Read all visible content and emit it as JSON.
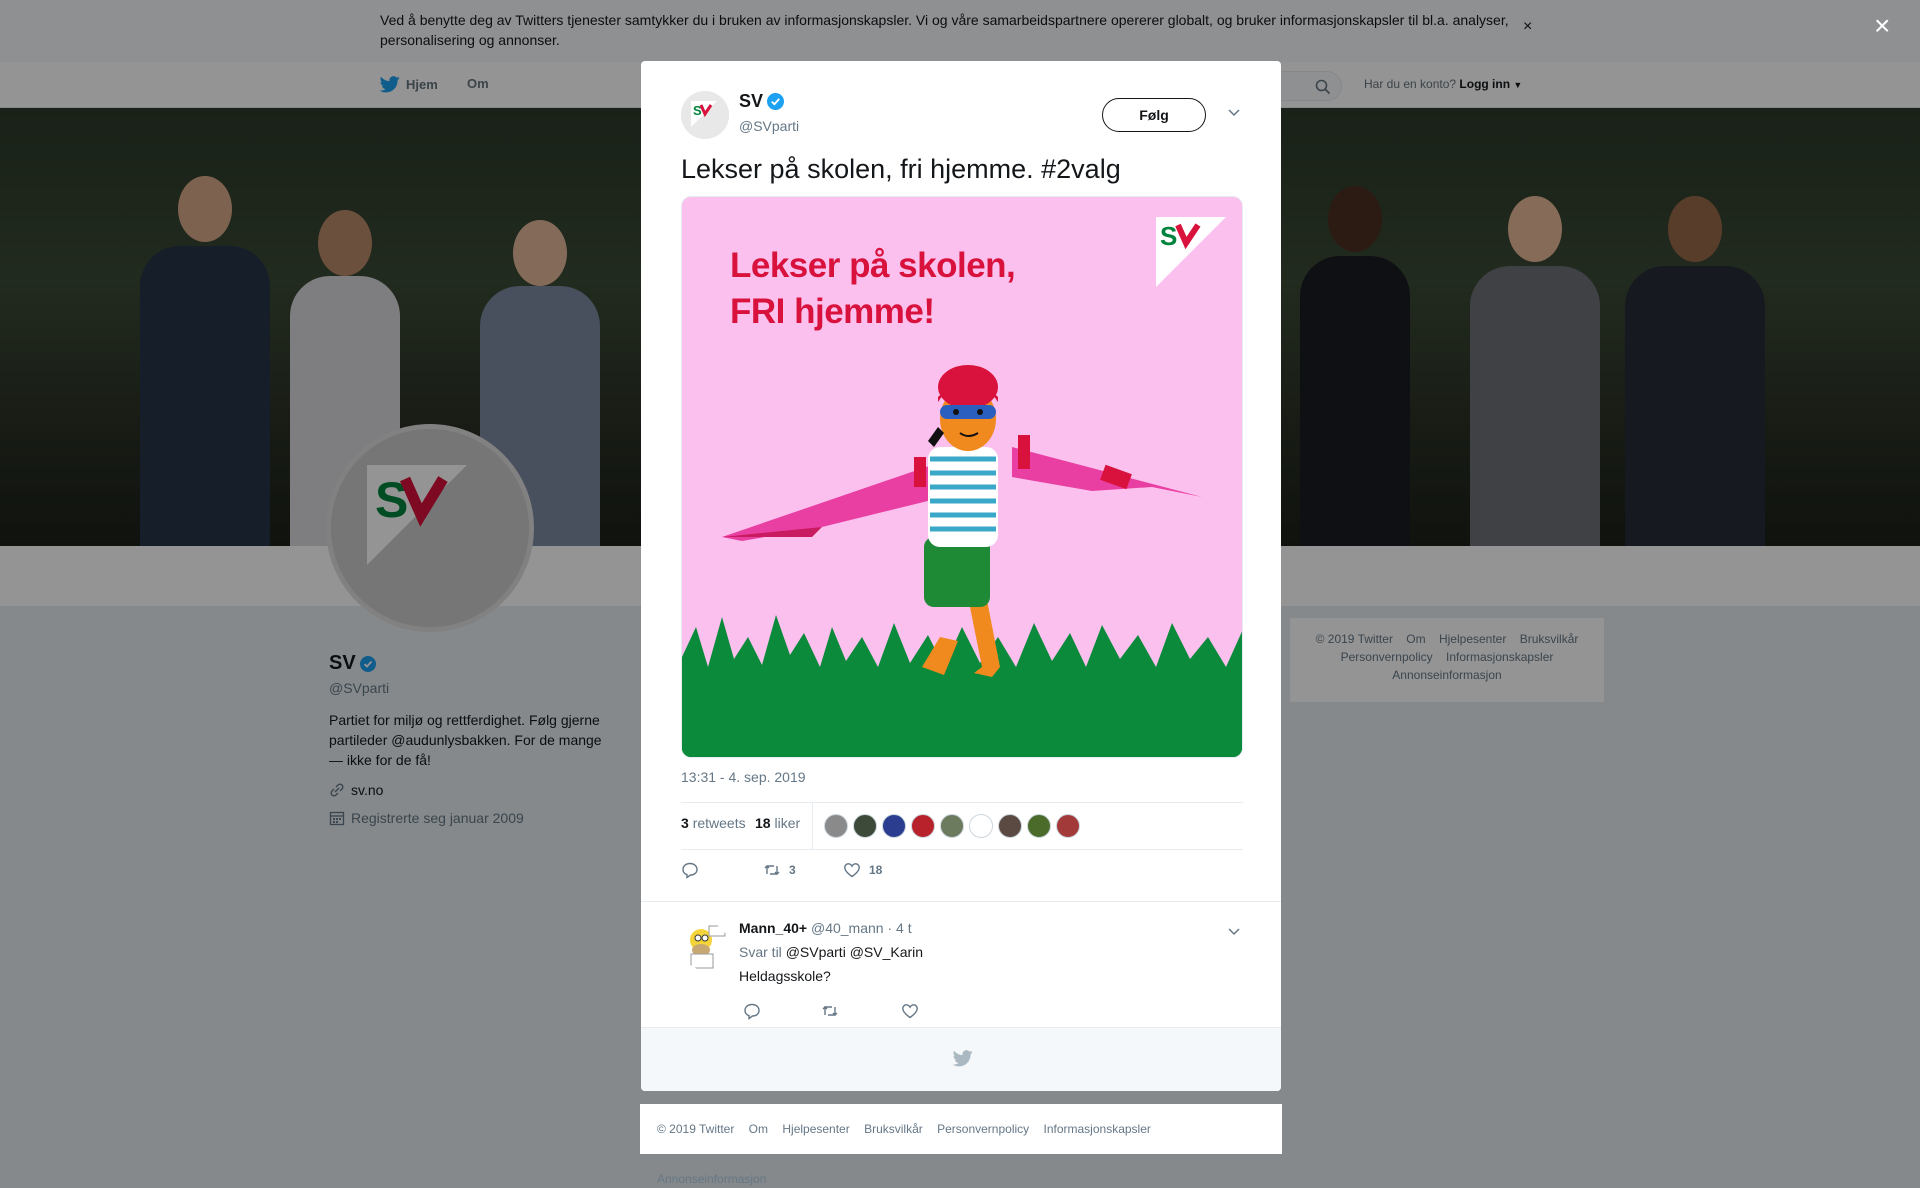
{
  "cookie": {
    "text": "Ved å benytte deg av Twitters tjenester samtykker du i bruken av informasjonskapsler. Vi og våre samarbeidspartnere opererer globalt, og bruker informasjonskapsler til bl.a. analyser, personalisering og annonser.",
    "close": "×"
  },
  "nav": {
    "home": "Hjem",
    "about": "Om",
    "have_account": "Har du en konto?",
    "login": "Logg inn"
  },
  "profile": {
    "name": "SV",
    "handle": "@SVparti",
    "bio": "Partiet for miljø og rettferdighet. Følg gjerne partileder @audunlysbakken. For de mange — ikke for de få!",
    "link": "sv.no",
    "joined": "Registrerte seg januar 2009"
  },
  "side_footer": [
    "© 2019 Twitter",
    "Om",
    "Hjelpesenter",
    "Bruksvilkår",
    "Personvernpolicy",
    "Informasjonskapsler",
    "Annonseinformasjon"
  ],
  "overlay_close": "×",
  "tweet": {
    "name": "SV",
    "handle": "@SVparti",
    "follow": "Følg",
    "text": "Lekser på skolen, fri hjemme. #2valg",
    "media_line1": "Lekser på skolen,",
    "media_line2": "FRI hjemme!",
    "media_logo": "SV",
    "time": "13:31 - 4. sep. 2019",
    "retweets_count": "3",
    "retweets_label": "retweets",
    "likes_count": "18",
    "likes_label": "liker",
    "action_retweets": "3",
    "action_likes": "18",
    "liker_colors": [
      "#8a8a8a",
      "#3d4a3a",
      "#2a3d8f",
      "#b8222b",
      "#6c7a5e",
      "#ffffff",
      "#5b4a42",
      "#4a6b2a",
      "#a33a3a"
    ]
  },
  "reply": {
    "name": "Mann_40+",
    "handle": "@40_mann",
    "time": "· 4 t",
    "reply_to_label": "Svar til",
    "mentions": "@SVparti @SV_Karin",
    "text": "Heldagsskole?"
  },
  "bottom_footer": [
    "© 2019 Twitter",
    "Om",
    "Hjelpesenter",
    "Bruksvilkår",
    "Personvernpolicy",
    "Informasjonskapsler",
    "Annonseinformasjon"
  ],
  "colors": {
    "accent": "#1da1f2",
    "sv_red": "#d8123c",
    "sv_green": "#00843d",
    "media_pink": "#fbc0ee"
  }
}
